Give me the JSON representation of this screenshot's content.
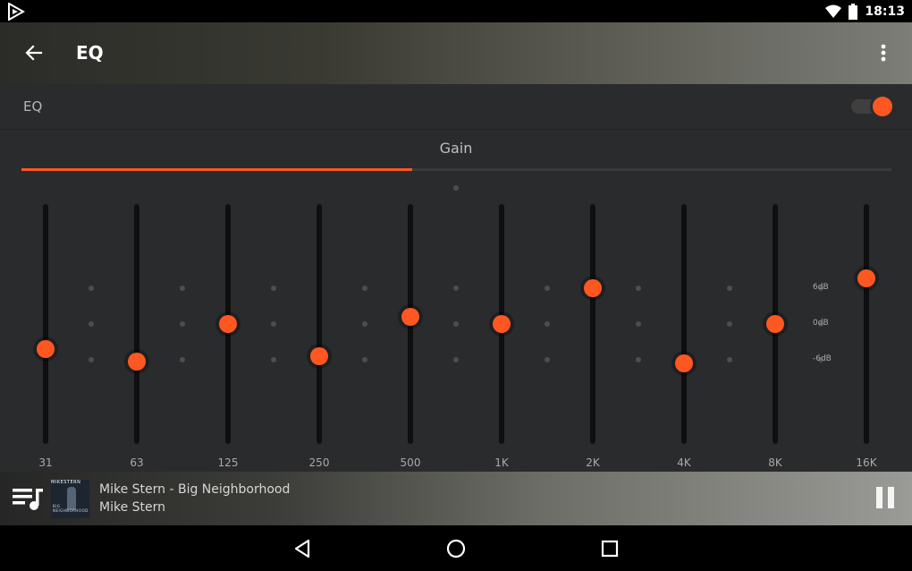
{
  "status_bar": {
    "time": "18:13",
    "icons": [
      "app-play-icon",
      "wifi-icon",
      "battery-icon"
    ]
  },
  "toolbar": {
    "title": "EQ",
    "back_icon": "arrow-back-icon",
    "menu_icon": "more-vert-icon"
  },
  "eq_toggle": {
    "label": "EQ",
    "enabled": true
  },
  "tab": {
    "label": "Gain"
  },
  "db_labels": [
    "6dB",
    "0dB",
    "-6dB"
  ],
  "bands": [
    {
      "freq": "31",
      "gain_db": -4.2
    },
    {
      "freq": "63",
      "gain_db": -6.2
    },
    {
      "freq": "125",
      "gain_db": 0.0
    },
    {
      "freq": "250",
      "gain_db": -5.4
    },
    {
      "freq": "500",
      "gain_db": 1.2
    },
    {
      "freq": "1K",
      "gain_db": 0.0
    },
    {
      "freq": "2K",
      "gain_db": 6.0
    },
    {
      "freq": "4K",
      "gain_db": -6.6
    },
    {
      "freq": "8K",
      "gain_db": 0.0
    },
    {
      "freq": "16K",
      "gain_db": 7.6
    }
  ],
  "gain_range_db": [
    -20,
    20
  ],
  "player": {
    "song": "Mike Stern - Big Neighborhood",
    "artist": "Mike Stern",
    "art_top": "MIKESTERN",
    "art_bottom": "BIG NEIGHBORHOOD"
  },
  "accent_color": "#ff5722",
  "navbar": {
    "icons": [
      "back-triangle-icon",
      "home-circle-icon",
      "recents-square-icon"
    ]
  }
}
